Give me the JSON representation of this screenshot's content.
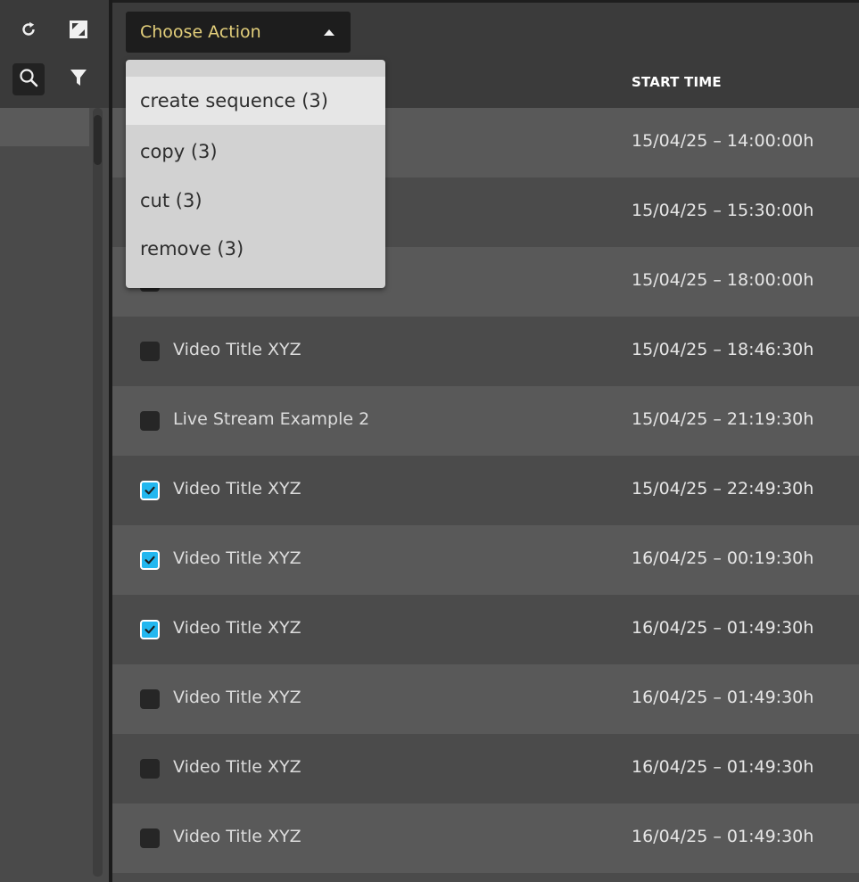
{
  "toolbar": {
    "refresh_icon": "refresh-icon",
    "expand_icon": "expand-icon",
    "search_icon": "search-icon",
    "filter_icon": "filter-icon"
  },
  "header": {
    "action_button_label": "Choose Action",
    "start_time_header": "START TIME"
  },
  "action_menu": {
    "items": [
      {
        "label": "create sequence (3)"
      },
      {
        "label": "copy (3)"
      },
      {
        "label": "cut (3)"
      },
      {
        "label": "remove (3)"
      }
    ]
  },
  "rows": [
    {
      "title": "",
      "start_time": "15/04/25 – 14:00:00h",
      "checked": false
    },
    {
      "title": "",
      "start_time": "15/04/25 – 15:30:00h",
      "checked": false
    },
    {
      "title": "",
      "start_time": "15/04/25 – 18:00:00h",
      "checked": false
    },
    {
      "title": "Video Title XYZ",
      "start_time": "15/04/25 – 18:46:30h",
      "checked": false
    },
    {
      "title": "Live Stream Example 2",
      "start_time": "15/04/25 – 21:19:30h",
      "checked": false
    },
    {
      "title": "Video Title XYZ",
      "start_time": "15/04/25 – 22:49:30h",
      "checked": true
    },
    {
      "title": "Video Title XYZ",
      "start_time": "16/04/25 – 00:19:30h",
      "checked": true
    },
    {
      "title": "Video Title XYZ",
      "start_time": "16/04/25 – 01:49:30h",
      "checked": true
    },
    {
      "title": "Video Title XYZ",
      "start_time": "16/04/25 – 01:49:30h",
      "checked": false
    },
    {
      "title": "Video Title XYZ",
      "start_time": "16/04/25 – 01:49:30h",
      "checked": false
    },
    {
      "title": "Video Title XYZ",
      "start_time": "16/04/25 – 01:49:30h",
      "checked": false
    }
  ],
  "colors": {
    "accent": "#23b7ef",
    "action_label": "#e3cf7b"
  }
}
